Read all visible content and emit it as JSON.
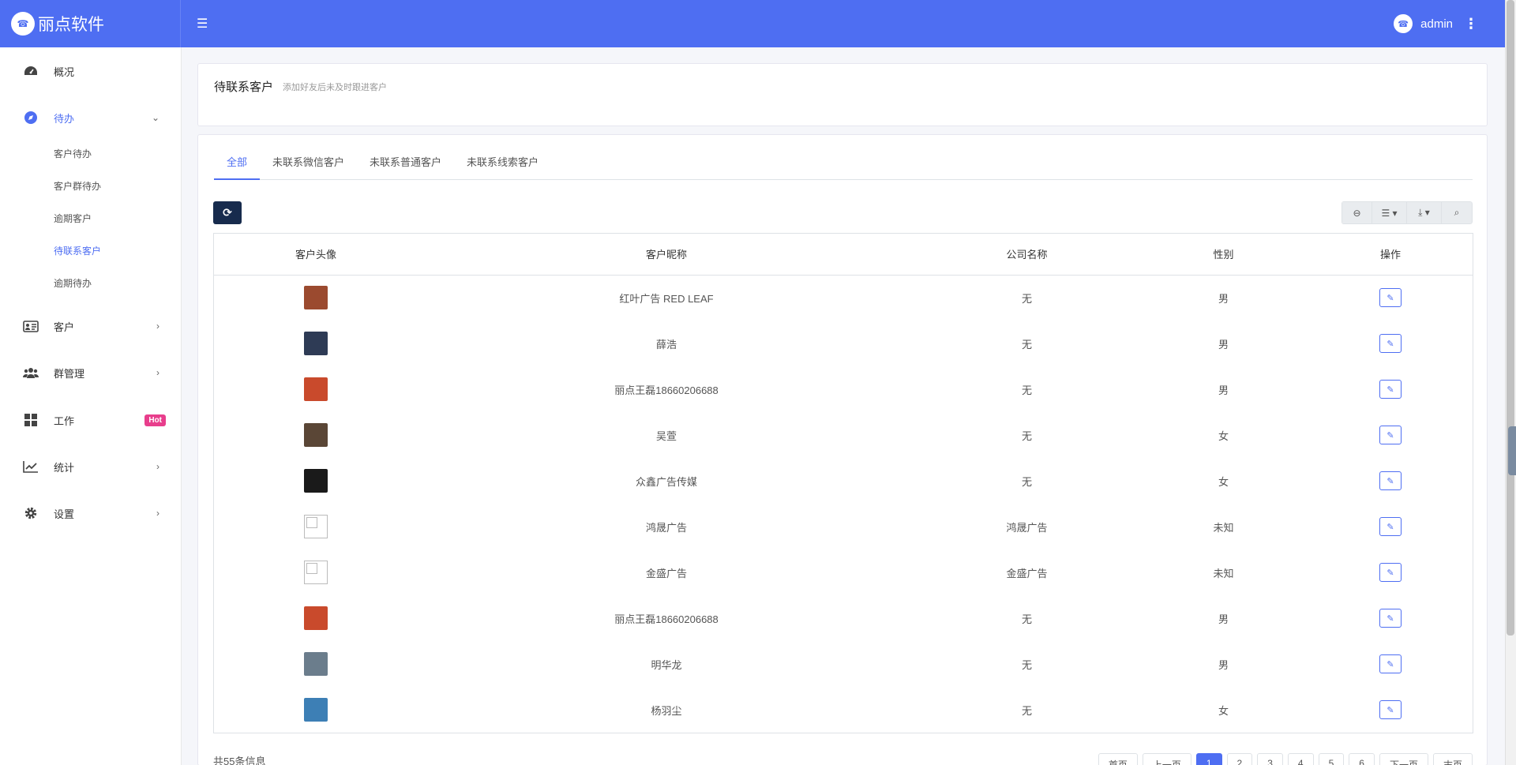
{
  "header": {
    "brand": "丽点软件",
    "user": "admin"
  },
  "sidebar": {
    "items": [
      {
        "label": "概况",
        "icon": "dashboard-icon"
      },
      {
        "label": "待办",
        "icon": "compass-icon"
      },
      {
        "label": "客户",
        "icon": "id-card-icon"
      },
      {
        "label": "群管理",
        "icon": "users-icon"
      },
      {
        "label": "工作",
        "icon": "grid-icon",
        "badge": "Hot"
      },
      {
        "label": "统计",
        "icon": "line-chart-icon"
      },
      {
        "label": "设置",
        "icon": "gear-icon"
      }
    ],
    "sub_items": [
      "客户待办",
      "客户群待办",
      "逾期客户",
      "待联系客户",
      "逾期待办"
    ]
  },
  "page": {
    "title": "待联系客户",
    "subtitle": "添加好友后未及时跟进客户"
  },
  "tabs": [
    "全部",
    "未联系微信客户",
    "未联系普通客户",
    "未联系线索客户"
  ],
  "table": {
    "columns": [
      "客户头像",
      "客户昵称",
      "公司名称",
      "性别",
      "操作"
    ],
    "rows": [
      {
        "avatar": "photo",
        "color": "#9b4a2f",
        "name": "红叶广告 RED LEAF",
        "company": "无",
        "gender": "男"
      },
      {
        "avatar": "photo",
        "color": "#2e3b55",
        "name": "薛浩",
        "company": "无",
        "gender": "男"
      },
      {
        "avatar": "photo",
        "color": "#c94a2c",
        "name": "丽点王磊18660206688",
        "company": "无",
        "gender": "男"
      },
      {
        "avatar": "photo",
        "color": "#5a4636",
        "name": "吴萱",
        "company": "无",
        "gender": "女"
      },
      {
        "avatar": "photo",
        "color": "#1a1a1a",
        "name": "众鑫广告传媒",
        "company": "无",
        "gender": "女"
      },
      {
        "avatar": "blank",
        "color": "#ffffff",
        "name": "鸿晟广告",
        "company": "鸿晟广告",
        "gender": "未知"
      },
      {
        "avatar": "blank",
        "color": "#ffffff",
        "name": "金盛广告",
        "company": "金盛广告",
        "gender": "未知"
      },
      {
        "avatar": "photo",
        "color": "#c94a2c",
        "name": "丽点王磊18660206688",
        "company": "无",
        "gender": "男"
      },
      {
        "avatar": "photo",
        "color": "#6b7d8c",
        "name": "明华龙",
        "company": "无",
        "gender": "男"
      },
      {
        "avatar": "photo",
        "color": "#3d7fb5",
        "name": "杨羽尘",
        "company": "无",
        "gender": "女"
      }
    ]
  },
  "footer": {
    "total": "共55条信息",
    "pager": [
      "首页",
      "上一页",
      "1",
      "2",
      "3",
      "4",
      "5",
      "6",
      "下一页",
      "末页"
    ],
    "current_page": "1"
  },
  "colors": {
    "primary": "#4e6ef2",
    "hot": "#e83e8c",
    "dark_button": "#172b4d"
  }
}
